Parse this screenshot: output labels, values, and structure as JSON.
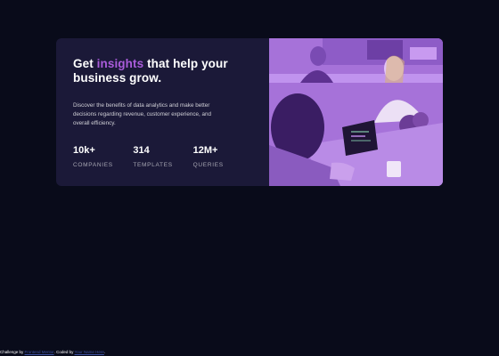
{
  "card": {
    "title_before": "Get ",
    "title_accent": "insights",
    "title_after": " that help your business grow.",
    "description": "Discover the benefits of data analytics and make better decisions regarding revenue, customer experience, and overall efficiency.",
    "stats": [
      {
        "value": "10k+",
        "label": "Companies"
      },
      {
        "value": "314",
        "label": "Templates"
      },
      {
        "value": "12M+",
        "label": "Queries"
      }
    ],
    "image_description": "image-header-desktop"
  },
  "attribution": {
    "prefix": "Challenge by ",
    "challenge_link": "Frontend Mentor",
    "middle": ". Coded by ",
    "author_link": "Your Name Here",
    "suffix": "."
  },
  "colors": {
    "background": "#090b1a",
    "card": "#1b1938",
    "accent": "#aa5cdb",
    "image_overlay": "#a36ed8"
  }
}
